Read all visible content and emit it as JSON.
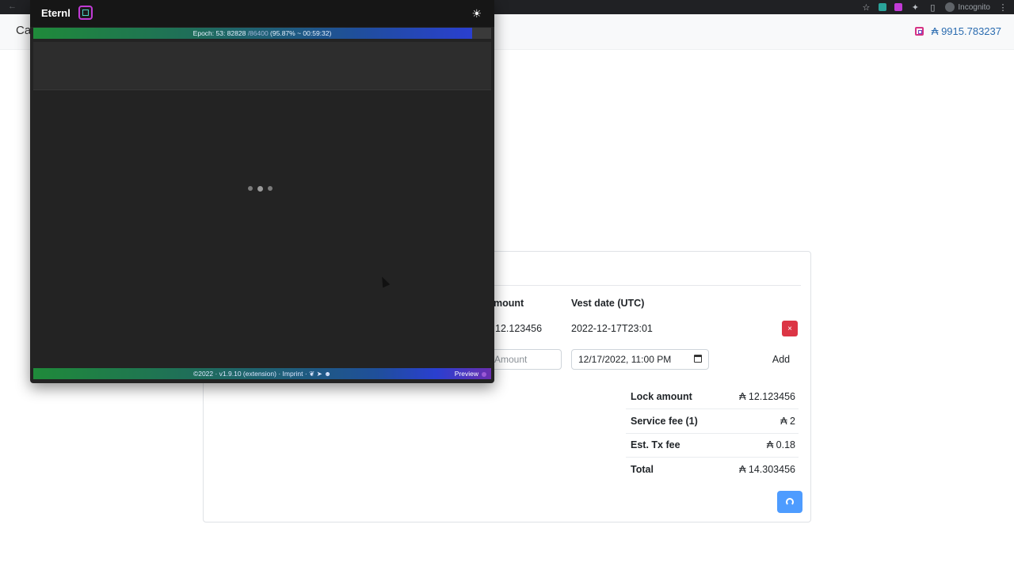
{
  "header": {
    "brand_partial": "Ca",
    "wallet_balance": "₳ 9915.783237"
  },
  "browser": {
    "profile_label": "Incognito"
  },
  "popup": {
    "title": "Eternl",
    "epoch": {
      "prefix": "Epoch: 53: 82828 ",
      "total": "/86400",
      "suffix": " (95.87% ~ 00:59:32)",
      "progress_fraction": 0.9587
    },
    "footer_text": "©2022 · v1.9.10 (extension) · Imprint ·",
    "preview_label": "Preview"
  },
  "vesting": {
    "columns": {
      "amount": "mount",
      "vest_date": "Vest date (UTC)"
    },
    "rows": [
      {
        "amount": "12.123456",
        "vest_date": "2022-12-17T23:01",
        "remove_label": "×"
      }
    ],
    "new_entry": {
      "amount_placeholder": "Amount",
      "date_value": "12/17/2022, 11:00 PM",
      "add_label": "Add"
    }
  },
  "summary": [
    {
      "label": "Lock amount",
      "value": "₳ 12.123456"
    },
    {
      "label": "Service fee (1)",
      "value": "₳ 2"
    },
    {
      "label": "Est. Tx fee",
      "value": "₳ 0.18"
    },
    {
      "label": "Total",
      "value": "₳ 14.303456"
    }
  ]
}
